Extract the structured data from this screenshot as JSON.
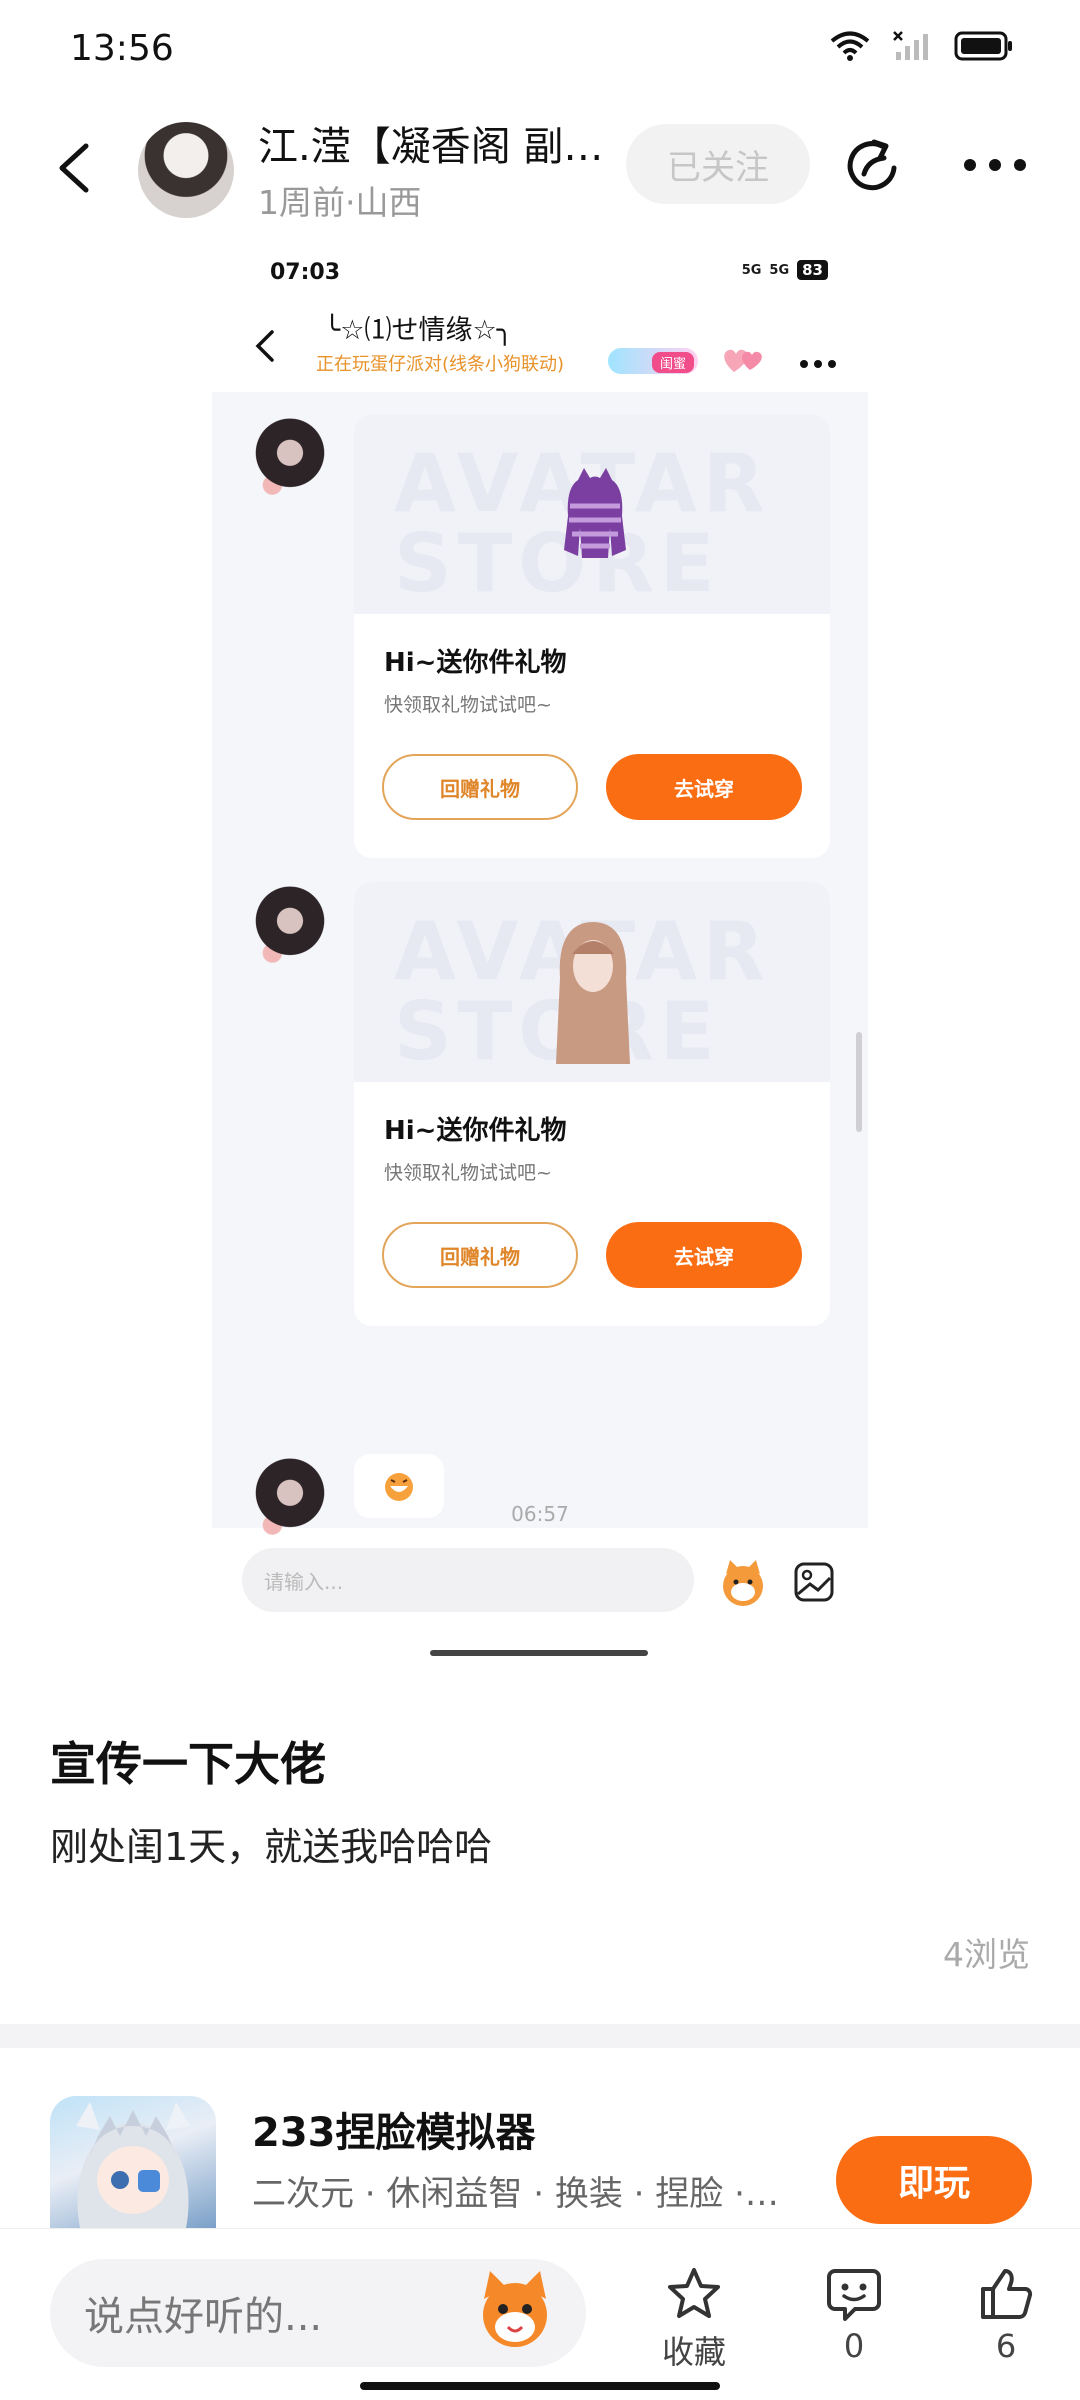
{
  "status_bar": {
    "time": "13:56"
  },
  "header": {
    "author_name": "江.滢【凝香阁 副…",
    "meta": "1周前·山西",
    "follow_label": "已关注"
  },
  "screenshot": {
    "status_time": "07:03",
    "signal_1": "5G",
    "signal_2": "5G",
    "battery": "83",
    "chat_title": "╰☆⑴せ情缘☆╮",
    "chat_subtitle": "正在玩蛋仔派对(线条小狗联动)",
    "relation_tag": "闺蜜",
    "gift_cards": [
      {
        "watermark": "AVATAR STORE",
        "title": "Hi~送你件礼物",
        "subtitle": "快领取礼物试试吧~",
        "return_label": "回赠礼物",
        "try_label": "去试穿"
      },
      {
        "watermark": "AVATAR STORE",
        "title": "Hi~送你件礼物",
        "subtitle": "快领取礼物试试吧~",
        "return_label": "回赠礼物",
        "try_label": "去试穿"
      }
    ],
    "timestamp": "06:57",
    "input_placeholder": "请输入..."
  },
  "post": {
    "title": "宣传一下大佬",
    "content": "刚处闺1天，就送我哈哈哈",
    "views": "4浏览"
  },
  "game": {
    "name": "233捏脸模拟器",
    "tags": "二次元 · 休闲益智 · 换装 · 捏脸 ·…",
    "play_label": "即玩"
  },
  "bottom_bar": {
    "comment_placeholder": "说点好听的...",
    "favorite_label": "收藏",
    "comment_count": "0",
    "like_count": "6"
  },
  "colors": {
    "accent": "#fa6d12",
    "muted": "#aaaaaa",
    "tag_pink": "#f04d8a"
  }
}
